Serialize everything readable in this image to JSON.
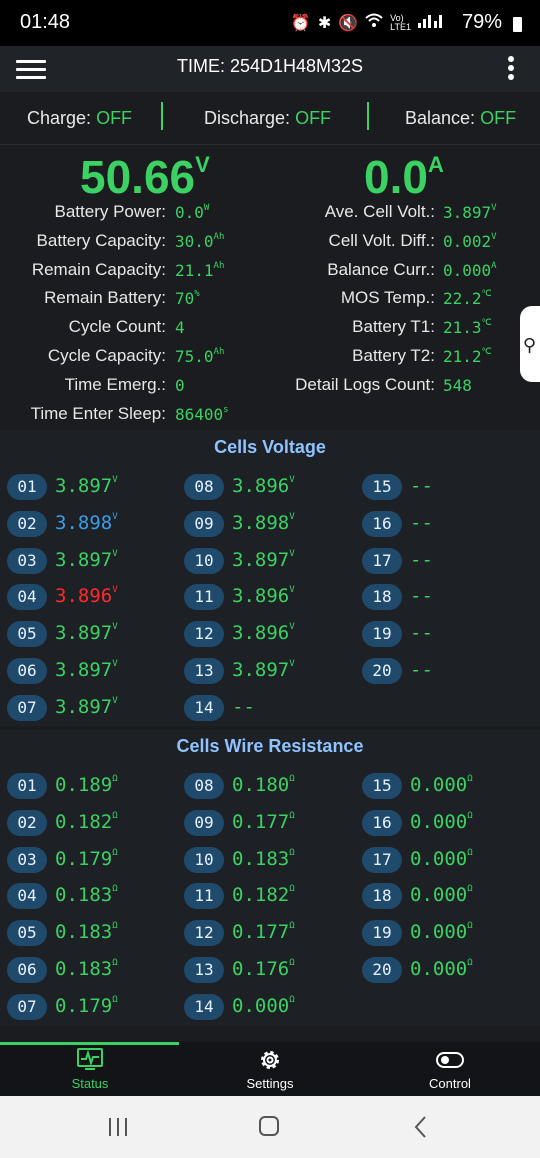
{
  "status_bar": {
    "time": "01:48",
    "battery": "79%",
    "icons": [
      "alarm-icon",
      "bluetooth-icon",
      "mute-icon",
      "wifi-icon",
      "volte-icon",
      "signal-icon"
    ]
  },
  "toolbar": {
    "title": "TIME: 254D1H48M32S"
  },
  "switches": [
    {
      "label": "Charge:",
      "value": "OFF"
    },
    {
      "label": "Discharge:",
      "value": "OFF"
    },
    {
      "label": "Balance:",
      "value": "OFF"
    }
  ],
  "main": {
    "voltage": "50.66",
    "voltage_unit": "V",
    "current": "0.0",
    "current_unit": "A",
    "left": [
      {
        "label": "Battery Power:",
        "value": "0.0",
        "unit": "W"
      },
      {
        "label": "Battery Capacity:",
        "value": "30.0",
        "unit": "Ah"
      },
      {
        "label": "Remain Capacity:",
        "value": "21.1",
        "unit": "Ah"
      },
      {
        "label": "Remain Battery:",
        "value": "70",
        "unit": "%"
      },
      {
        "label": "Cycle Count:",
        "value": "4",
        "unit": ""
      },
      {
        "label": "Cycle Capacity:",
        "value": "75.0",
        "unit": "Ah"
      },
      {
        "label": "Time Emerg.:",
        "value": "0",
        "unit": ""
      },
      {
        "label": "Time Enter Sleep:",
        "value": "86400",
        "unit": "s"
      }
    ],
    "right": [
      {
        "label": "Ave. Cell Volt.:",
        "value": "3.897",
        "unit": "V"
      },
      {
        "label": "Cell Volt. Diff.:",
        "value": "0.002",
        "unit": "V"
      },
      {
        "label": "Balance Curr.:",
        "value": "0.000",
        "unit": "A"
      },
      {
        "label": "MOS Temp.:",
        "value": "22.2",
        "unit": "℃"
      },
      {
        "label": "Battery T1:",
        "value": "21.3",
        "unit": "℃"
      },
      {
        "label": "Battery T2:",
        "value": "21.2",
        "unit": "℃"
      },
      {
        "label": "Detail Logs Count:",
        "value": "548",
        "unit": ""
      }
    ]
  },
  "cells_voltage": {
    "title": "Cells Voltage",
    "unit": "V",
    "cells": [
      {
        "id": "01",
        "value": "3.897",
        "state": "normal"
      },
      {
        "id": "02",
        "value": "3.898",
        "state": "max"
      },
      {
        "id": "03",
        "value": "3.897",
        "state": "normal"
      },
      {
        "id": "04",
        "value": "3.896",
        "state": "min"
      },
      {
        "id": "05",
        "value": "3.897",
        "state": "normal"
      },
      {
        "id": "06",
        "value": "3.897",
        "state": "normal"
      },
      {
        "id": "07",
        "value": "3.897",
        "state": "normal"
      },
      {
        "id": "08",
        "value": "3.896",
        "state": "normal"
      },
      {
        "id": "09",
        "value": "3.898",
        "state": "normal"
      },
      {
        "id": "10",
        "value": "3.897",
        "state": "normal"
      },
      {
        "id": "11",
        "value": "3.896",
        "state": "normal"
      },
      {
        "id": "12",
        "value": "3.896",
        "state": "normal"
      },
      {
        "id": "13",
        "value": "3.897",
        "state": "normal"
      },
      {
        "id": "14",
        "value": "--",
        "state": "none"
      },
      {
        "id": "15",
        "value": "--",
        "state": "none"
      },
      {
        "id": "16",
        "value": "--",
        "state": "none"
      },
      {
        "id": "17",
        "value": "--",
        "state": "none"
      },
      {
        "id": "18",
        "value": "--",
        "state": "none"
      },
      {
        "id": "19",
        "value": "--",
        "state": "none"
      },
      {
        "id": "20",
        "value": "--",
        "state": "none"
      }
    ]
  },
  "cells_resistance": {
    "title": "Cells Wire Resistance",
    "unit": "Ω",
    "cells": [
      {
        "id": "01",
        "value": "0.189"
      },
      {
        "id": "02",
        "value": "0.182"
      },
      {
        "id": "03",
        "value": "0.179"
      },
      {
        "id": "04",
        "value": "0.183"
      },
      {
        "id": "05",
        "value": "0.183"
      },
      {
        "id": "06",
        "value": "0.183"
      },
      {
        "id": "07",
        "value": "0.179"
      },
      {
        "id": "08",
        "value": "0.180"
      },
      {
        "id": "09",
        "value": "0.177"
      },
      {
        "id": "10",
        "value": "0.183"
      },
      {
        "id": "11",
        "value": "0.182"
      },
      {
        "id": "12",
        "value": "0.177"
      },
      {
        "id": "13",
        "value": "0.176"
      },
      {
        "id": "14",
        "value": "0.000"
      },
      {
        "id": "15",
        "value": "0.000"
      },
      {
        "id": "16",
        "value": "0.000"
      },
      {
        "id": "17",
        "value": "0.000"
      },
      {
        "id": "18",
        "value": "0.000"
      },
      {
        "id": "19",
        "value": "0.000"
      },
      {
        "id": "20",
        "value": "0.000"
      }
    ]
  },
  "bottom_nav": [
    {
      "label": "Status",
      "icon": "monitor-icon",
      "active": true
    },
    {
      "label": "Settings",
      "icon": "gear-icon",
      "active": false
    },
    {
      "label": "Control",
      "icon": "toggle-icon",
      "active": false
    }
  ],
  "colors": {
    "accent": "#3bd163",
    "max_cell": "#3c9ce8",
    "min_cell": "#ff2a2a",
    "section_title": "#8fc3ff",
    "badge": "#1f4a6b"
  }
}
